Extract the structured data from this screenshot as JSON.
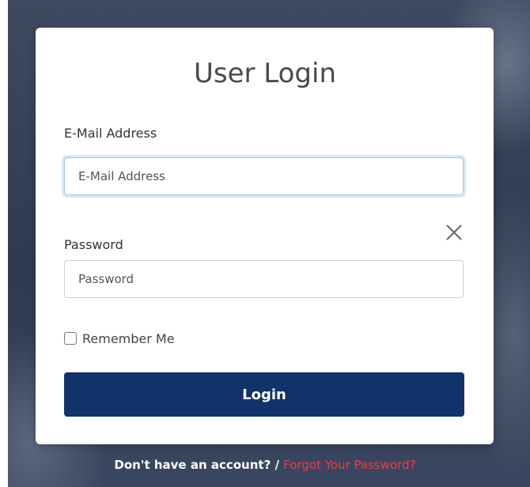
{
  "login": {
    "title": "User Login",
    "email_label": "E-Mail Address",
    "email_placeholder": "E-Mail Address",
    "email_value": "",
    "password_label": "Password",
    "password_placeholder": "Password",
    "password_value": "",
    "remember_label": "Remember Me",
    "remember_checked": false,
    "submit_label": "Login",
    "close_icon": "close-icon"
  },
  "footer": {
    "signup_text": "Don't have an account? /",
    "forgot_link": "Forgot Your Password?"
  },
  "colors": {
    "button": "#12326a",
    "link": "#e5404a",
    "focus_border": "#a9c2e6"
  }
}
